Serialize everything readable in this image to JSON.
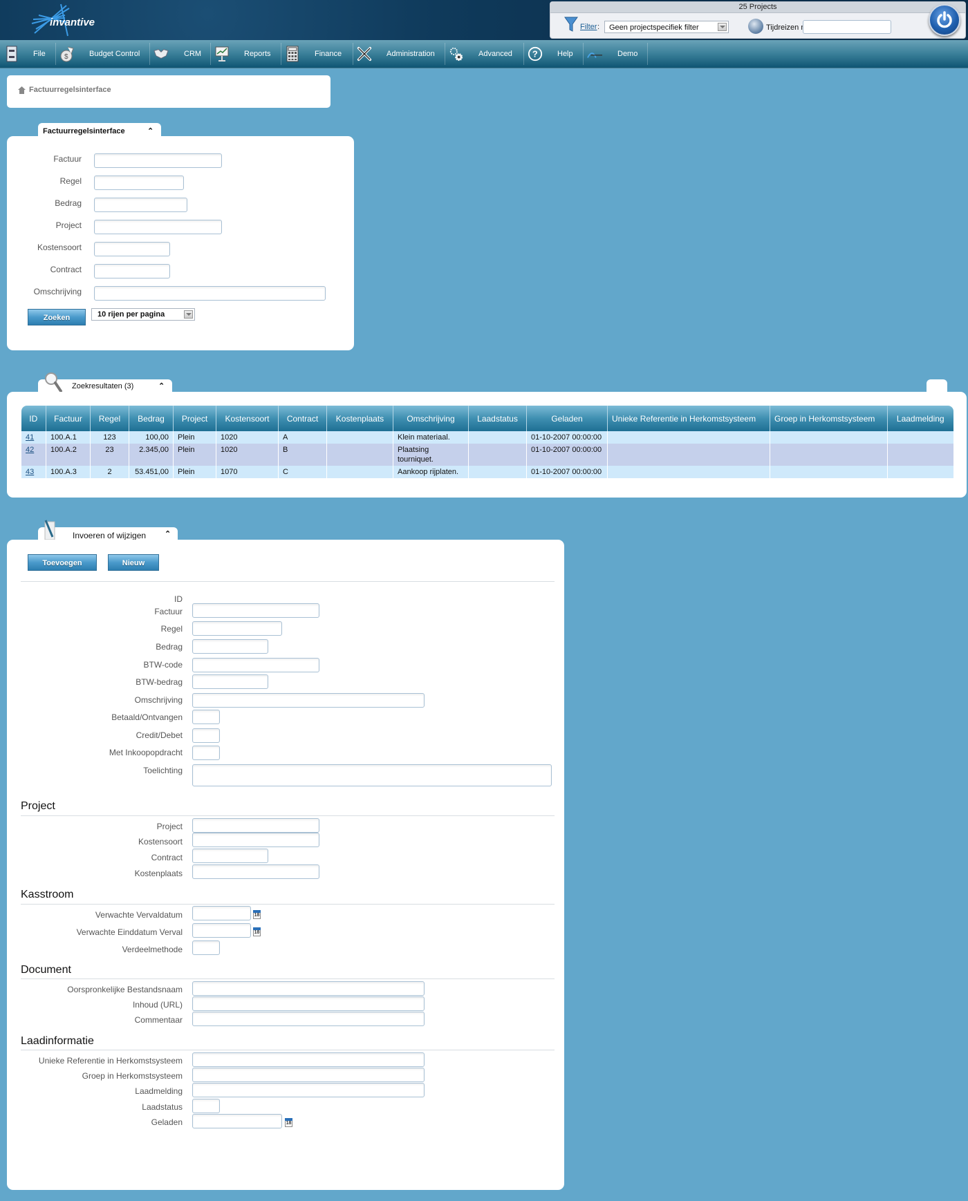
{
  "header": {
    "logo_text": "invantive",
    "projects_count": "25 Projects",
    "filter_link": "Filter",
    "filter_colon": ":",
    "filter_select_value": "Geen projectspecifiek filter",
    "time_travel_label": "Tijdreizen naar:",
    "time_travel_value": ""
  },
  "nav": {
    "items": [
      {
        "label": "File",
        "icon": "file-cabinet-icon"
      },
      {
        "label": "Budget Control",
        "icon": "money-bag-icon"
      },
      {
        "label": "CRM",
        "icon": "handshake-icon"
      },
      {
        "label": "Reports",
        "icon": "presentation-chart-icon"
      },
      {
        "label": "Finance",
        "icon": "calculator-icon"
      },
      {
        "label": "Administration",
        "icon": "tools-icon"
      },
      {
        "label": "Advanced",
        "icon": "gears-icon"
      },
      {
        "label": "Help",
        "icon": "help-icon"
      },
      {
        "label": "Demo",
        "icon": "demo-logo-icon"
      }
    ]
  },
  "breadcrumb": {
    "home_icon": "home-icon",
    "current": "Factuurregelsinterface"
  },
  "search_panel": {
    "title": "Factuurregelsinterface",
    "collapse_icon": "collapse-up-icon",
    "fields": [
      {
        "label": "Factuur",
        "value": ""
      },
      {
        "label": "Regel",
        "value": ""
      },
      {
        "label": "Bedrag",
        "value": ""
      },
      {
        "label": "Project",
        "value": ""
      },
      {
        "label": "Kostensoort",
        "value": ""
      },
      {
        "label": "Contract",
        "value": ""
      },
      {
        "label": "Omschrijving",
        "value": ""
      }
    ],
    "search_button": "Zoeken",
    "rows_per_page": "10 rijen per pagina"
  },
  "results_panel": {
    "title": "Zoekresultaten (3)",
    "collapse_icon": "collapse-up-icon",
    "columns": [
      "ID",
      "Factuur",
      "Regel",
      "Bedrag",
      "Project",
      "Kostensoort",
      "Contract",
      "Kostenplaats",
      "Omschrijving",
      "Laadstatus",
      "Geladen",
      "Unieke Referentie in Herkomstsysteem",
      "Groep in Herkomstsysteem",
      "Laadmelding"
    ],
    "rows": [
      {
        "id": "41",
        "factuur": "100.A.1",
        "regel": "123",
        "bedrag": "100,00",
        "project": "Plein",
        "kostensoort": "1020",
        "contract": "A",
        "kostenplaats": "",
        "omschrijving": "Klein materiaal.",
        "laadstatus": "",
        "geladen": "01-10-2007 00:00:00",
        "unieke_referentie": "",
        "groep": "",
        "laadmelding": ""
      },
      {
        "id": "42",
        "factuur": "100.A.2",
        "regel": "23",
        "bedrag": "2.345,00",
        "project": "Plein",
        "kostensoort": "1020",
        "contract": "B",
        "kostenplaats": "",
        "omschrijving": "Plaatsing tourniquet.",
        "laadstatus": "",
        "geladen": "01-10-2007 00:00:00",
        "unieke_referentie": "",
        "groep": "",
        "laadmelding": ""
      },
      {
        "id": "43",
        "factuur": "100.A.3",
        "regel": "2",
        "bedrag": "53.451,00",
        "project": "Plein",
        "kostensoort": "1070",
        "contract": "C",
        "kostenplaats": "",
        "omschrijving": "Aankoop rijplaten.",
        "laadstatus": "",
        "geladen": "01-10-2007 00:00:00",
        "unieke_referentie": "",
        "groep": "",
        "laadmelding": ""
      }
    ]
  },
  "edit_panel": {
    "title": "Invoeren of wijzigen",
    "collapse_icon": "collapse-up-icon",
    "add_button": "Toevoegen",
    "new_button": "Nieuw",
    "id_label": "ID",
    "id_value": "",
    "general_fields": [
      {
        "label": "Factuur",
        "value": ""
      },
      {
        "label": "Regel",
        "value": ""
      },
      {
        "label": "Bedrag",
        "value": ""
      },
      {
        "label": "BTW-code",
        "value": ""
      },
      {
        "label": "BTW-bedrag",
        "value": ""
      },
      {
        "label": "Omschrijving",
        "value": ""
      },
      {
        "label": "Betaald/Ontvangen",
        "value": ""
      },
      {
        "label": "Credit/Debet",
        "value": ""
      },
      {
        "label": "Met Inkoopopdracht",
        "value": ""
      },
      {
        "label": "Toelichting",
        "value": ""
      }
    ],
    "sections": [
      {
        "title": "Project",
        "fields": [
          {
            "label": "Project",
            "value": ""
          },
          {
            "label": "Kostensoort",
            "value": ""
          },
          {
            "label": "Contract",
            "value": ""
          },
          {
            "label": "Kostenplaats",
            "value": ""
          }
        ]
      },
      {
        "title": "Kasstroom",
        "fields": [
          {
            "label": "Verwachte Vervaldatum",
            "value": ""
          },
          {
            "label": "Verwachte Einddatum Verval",
            "value": ""
          },
          {
            "label": "Verdeelmethode",
            "value": ""
          }
        ]
      },
      {
        "title": "Document",
        "fields": [
          {
            "label": "Oorspronkelijke Bestandsnaam",
            "value": ""
          },
          {
            "label": "Inhoud (URL)",
            "value": ""
          },
          {
            "label": "Commentaar",
            "value": ""
          }
        ]
      },
      {
        "title": "Laadinformatie",
        "fields": [
          {
            "label": "Unieke Referentie in Herkomstsysteem",
            "value": ""
          },
          {
            "label": "Groep in Herkomstsysteem",
            "value": ""
          },
          {
            "label": "Laadmelding",
            "value": ""
          },
          {
            "label": "Laadstatus",
            "value": ""
          },
          {
            "label": "Geladen",
            "value": ""
          }
        ]
      }
    ],
    "calendar_icon_text": "18"
  }
}
